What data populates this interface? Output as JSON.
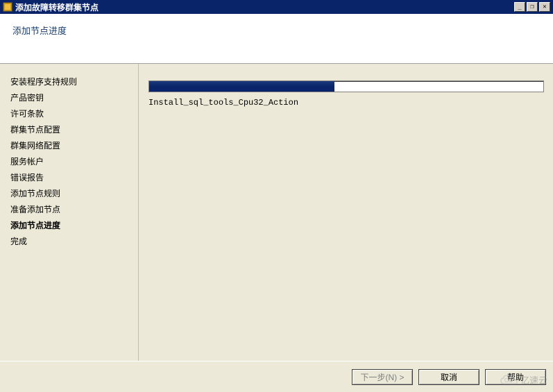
{
  "window": {
    "title": "添加故障转移群集节点",
    "controls": {
      "minimize": "_",
      "maximize": "❐",
      "close": "✕"
    }
  },
  "header": {
    "title": "添加节点进度"
  },
  "sidebar": {
    "items": [
      {
        "label": "安装程序支持规则",
        "active": false
      },
      {
        "label": "产品密钥",
        "active": false
      },
      {
        "label": "许可条款",
        "active": false
      },
      {
        "label": "群集节点配置",
        "active": false
      },
      {
        "label": "群集网络配置",
        "active": false
      },
      {
        "label": "服务帐户",
        "active": false
      },
      {
        "label": "错误报告",
        "active": false
      },
      {
        "label": "添加节点规则",
        "active": false
      },
      {
        "label": "准备添加节点",
        "active": false
      },
      {
        "label": "添加节点进度",
        "active": true
      },
      {
        "label": "完成",
        "active": false
      }
    ]
  },
  "progress": {
    "percent": 47,
    "status_text": "Install_sql_tools_Cpu32_Action"
  },
  "footer": {
    "next_label": "下一步(N) >",
    "cancel_label": "取消",
    "help_label": "帮助"
  },
  "watermark": {
    "text": "亿速云"
  }
}
